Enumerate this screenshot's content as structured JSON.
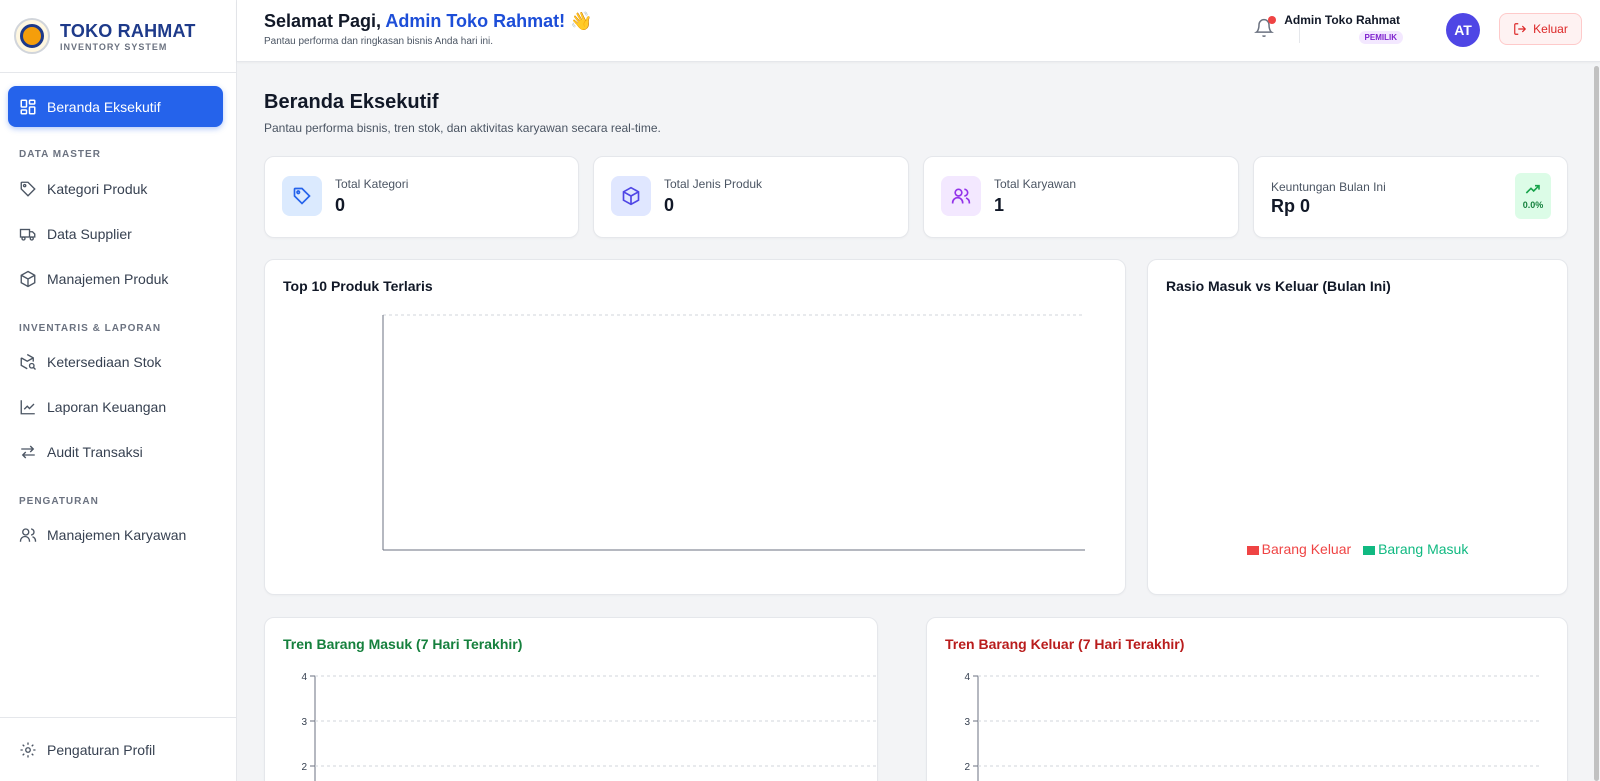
{
  "brand": {
    "name": "TOKO RAHMAT",
    "subtitle": "INVENTORY SYSTEM"
  },
  "sidebar": {
    "active": {
      "label": "Beranda Eksekutif",
      "icon": "dashboard-icon"
    },
    "sections": [
      {
        "title": "DATA MASTER",
        "items": [
          {
            "label": "Kategori Produk",
            "icon": "tag-icon"
          },
          {
            "label": "Data Supplier",
            "icon": "truck-icon"
          },
          {
            "label": "Manajemen Produk",
            "icon": "box-icon"
          }
        ]
      },
      {
        "title": "INVENTARIS & LAPORAN",
        "items": [
          {
            "label": "Ketersediaan Stok",
            "icon": "package-search-icon"
          },
          {
            "label": "Laporan Keuangan",
            "icon": "line-chart-icon"
          },
          {
            "label": "Audit Transaksi",
            "icon": "arrows-swap-icon"
          }
        ]
      },
      {
        "title": "PENGATURAN",
        "items": [
          {
            "label": "Manajemen Karyawan",
            "icon": "users-icon"
          }
        ]
      }
    ],
    "footer": {
      "label": "Pengaturan Profil",
      "icon": "gear-icon"
    }
  },
  "header": {
    "greeting_prefix": "Selamat Pagi,",
    "greeting_name": "Admin Toko Rahmat!",
    "greeting_emoji": "👋",
    "subtitle": "Pantau performa dan ringkasan bisnis Anda hari ini.",
    "user_name": "Admin Toko Rahmat",
    "user_role": "PEMILIK",
    "avatar_initials": "AT",
    "logout_label": "Keluar"
  },
  "page": {
    "title": "Beranda Eksekutif",
    "subtitle": "Pantau performa bisnis, tren stok, dan aktivitas karyawan secara real-time."
  },
  "stats": [
    {
      "label": "Total Kategori",
      "value": "0",
      "icon": "tag-icon",
      "color": "#2563eb",
      "bg": "#dbeafe"
    },
    {
      "label": "Total Jenis Produk",
      "value": "0",
      "icon": "box-icon",
      "color": "#4f46e5",
      "bg": "#e0e7ff"
    },
    {
      "label": "Total Karyawan",
      "value": "1",
      "icon": "users-icon",
      "color": "#9333ea",
      "bg": "#f3e8ff"
    },
    {
      "label": "Keuntungan Bulan Ini",
      "value": "Rp 0",
      "trend": "0.0%",
      "icon": "trending-up-icon",
      "color": "#16a34a"
    }
  ],
  "charts": {
    "top_products": {
      "title": "Top 10 Produk Terlaris"
    },
    "ratio": {
      "title": "Rasio Masuk vs Keluar (Bulan Ini)",
      "legend": [
        {
          "label": "Barang Keluar",
          "color": "#ef4444"
        },
        {
          "label": "Barang Masuk",
          "color": "#10b981"
        }
      ]
    },
    "trend_in": {
      "title": "Tren Barang Masuk (7 Hari Terakhir)",
      "color": "#15803d"
    },
    "trend_out": {
      "title": "Tren Barang Keluar (7 Hari Terakhir)",
      "color": "#b91c1c"
    }
  },
  "chart_data": [
    {
      "type": "bar",
      "title": "Top 10 Produk Terlaris",
      "categories": [],
      "values": []
    },
    {
      "type": "pie",
      "title": "Rasio Masuk vs Keluar (Bulan Ini)",
      "labels": [
        "Barang Keluar",
        "Barang Masuk"
      ],
      "values": [
        0,
        0
      ],
      "legend": "bottom"
    },
    {
      "type": "line",
      "title": "Tren Barang Masuk (7 Hari Terakhir)",
      "y_ticks": [
        "4",
        "3",
        "2"
      ],
      "ylim": [
        0,
        4
      ],
      "grid": true
    },
    {
      "type": "line",
      "title": "Tren Barang Keluar (7 Hari Terakhir)",
      "y_ticks": [
        "4",
        "3",
        "2"
      ],
      "ylim": [
        0,
        4
      ],
      "grid": true
    }
  ]
}
